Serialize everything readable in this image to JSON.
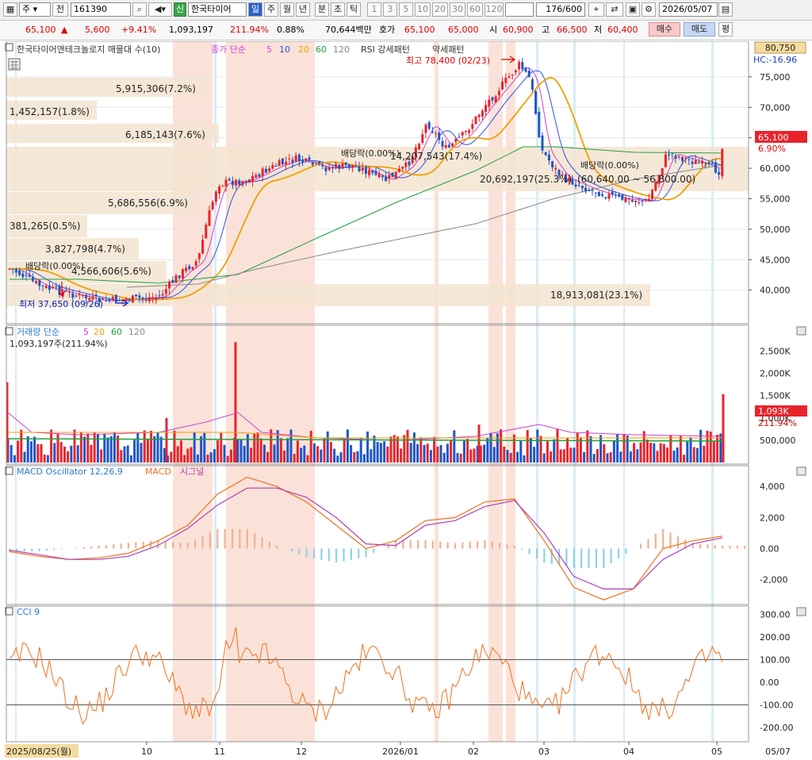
{
  "toolbar": {
    "type_label": "주",
    "jeon_label": "전",
    "stock_code": "161390",
    "market_badge": "신",
    "stock_name": "한국타이어",
    "period_tabs": [
      "일",
      "주",
      "월",
      "년",
      "분",
      "초",
      "틱"
    ],
    "minute_steps": [
      "1",
      "3",
      "5",
      "10",
      "20",
      "30",
      "60",
      "120"
    ],
    "count_display": "176/600",
    "date_value": "2026/05/07"
  },
  "quote": {
    "price": "65,100",
    "change": "5,600",
    "change_pct": "+9.41%",
    "volume": "1,093,197",
    "volume_ratio": "211.94%",
    "turnover_pct": "0.88%",
    "amount": "70,644백만",
    "hoga_label": "호가",
    "ask": "65,100",
    "bid": "65,000",
    "open_label": "시",
    "open": "60,900",
    "high_label": "고",
    "high": "66,500",
    "low_label": "저",
    "low": "60,400",
    "buy_button": "매수",
    "sell_button": "매도",
    "avg_button": "평"
  },
  "price_panel": {
    "header": {
      "title": "한국타이어앤테크놀로지 매물대 수(10)",
      "ma_label": "종가 단순",
      "ma_periods": [
        "5",
        "10",
        "20",
        "60",
        "120"
      ],
      "patterns": [
        "RSI 강세패턴",
        "약세패턴"
      ]
    },
    "y_ticks": [
      "75,000",
      "70,000",
      "65,000",
      "60,000",
      "55,000",
      "50,000",
      "45,000",
      "40,000"
    ],
    "top_tag": "80,750",
    "hc_tag": "HC:-16.96",
    "current_tag": "65,100",
    "current_pct": "6.90%",
    "high_note": "최고 78,400 (02/23)",
    "low_note": "최저 37,650 (09/26)",
    "dividend_labels": [
      "배당락(0.00%)",
      "배당락(0.00%)",
      "배당락(0.00%)"
    ],
    "volume_profile": [
      {
        "value": "5,915,306(7.2%)"
      },
      {
        "value": "1,452,157(1.8%)"
      },
      {
        "value": "6,185,143(7.6%)"
      },
      {
        "value": "14,207,543(17.4%)"
      },
      {
        "value": "20,692,197(25.3%)"
      },
      {
        "value": "5,686,556(6.9%)"
      },
      {
        "value": "381,265(0.5%)"
      },
      {
        "value": "3,827,798(4.7%)"
      },
      {
        "value": "4,566,606(5.6%)"
      },
      {
        "value": "18,913,081(23.1%)"
      }
    ],
    "avg_cost_label": "(60,640.00 ~ 56,800.00)"
  },
  "volume_panel": {
    "title": "거래량 단순",
    "ma_periods": [
      "5",
      "20",
      "60",
      "120"
    ],
    "sub": "1,093,197주(211.94%)",
    "y_ticks": [
      "2,500K",
      "2,000K",
      "1,500K",
      "1,000K",
      "500,000"
    ],
    "current_tag": "1,093K",
    "current_pct": "211.94%"
  },
  "macd_panel": {
    "title": "MACD Oscillator 12,26,9",
    "macd_label": "MACD",
    "signal_label": "시그널",
    "y_ticks": [
      "4,000",
      "2,000",
      "0.00",
      "-2,000"
    ]
  },
  "cci_panel": {
    "title": "CCI 9",
    "y_ticks": [
      "300.00",
      "200.00",
      "100.00",
      "0.00",
      "-100.00",
      "-200.00"
    ]
  },
  "x_axis": {
    "start_label": "2025/08/25(월)",
    "ticks": [
      "10",
      "11",
      "12",
      "2026/01",
      "02",
      "03",
      "04",
      "05"
    ],
    "end_label": "05/07"
  },
  "colors": {
    "up": "#e8242b",
    "down": "#1f56c8",
    "ma5": "#d040d0",
    "ma10": "#3050e0",
    "ma20": "#f0a000",
    "ma60": "#20a040",
    "ma120": "#888888",
    "macd": "#f07020",
    "signal": "#b040b0",
    "highlight": "#f9d8cc",
    "profile": "#f3e4d0"
  },
  "chart_data": [
    {
      "type": "candlestick",
      "title": "한국타이어앤테크놀로지",
      "x_range": [
        "2025/08/25",
        "2026/05/07"
      ],
      "ylim": [
        36000,
        80750
      ],
      "month_ticks": [
        "10",
        "11",
        "12",
        "2026/01",
        "02",
        "03",
        "04",
        "05"
      ],
      "close_points": [
        {
          "date": "2025/08/25",
          "close": 43500
        },
        {
          "date": "2025/09/05",
          "close": 40500
        },
        {
          "date": "2025/09/26",
          "close": 38200
        },
        {
          "date": "2025/10/17",
          "close": 38900
        },
        {
          "date": "2025/10/24",
          "close": 42500
        },
        {
          "date": "2025/10/31",
          "close": 45000
        },
        {
          "date": "2025/11/03",
          "close": 51000
        },
        {
          "date": "2025/11/07",
          "close": 57500
        },
        {
          "date": "2025/11/17",
          "close": 58000
        },
        {
          "date": "2025/11/28",
          "close": 60500
        },
        {
          "date": "2025/12/05",
          "close": 61500
        },
        {
          "date": "2025/12/15",
          "close": 60000
        },
        {
          "date": "2025/12/26",
          "close": 60500
        },
        {
          "date": "2026/01/06",
          "close": 58000
        },
        {
          "date": "2026/01/14",
          "close": 60500
        },
        {
          "date": "2026/01/21",
          "close": 67500
        },
        {
          "date": "2026/01/28",
          "close": 63000
        },
        {
          "date": "2026/02/04",
          "close": 66000
        },
        {
          "date": "2026/02/11",
          "close": 70500
        },
        {
          "date": "2026/02/23",
          "close": 77000
        },
        {
          "date": "2026/02/27",
          "close": 74500
        },
        {
          "date": "2026/03/03",
          "close": 63000
        },
        {
          "date": "2026/03/10",
          "close": 58500
        },
        {
          "date": "2026/03/20",
          "close": 56500
        },
        {
          "date": "2026/03/31",
          "close": 55000
        },
        {
          "date": "2026/04/10",
          "close": 54500
        },
        {
          "date": "2026/04/17",
          "close": 62500
        },
        {
          "date": "2026/04/27",
          "close": 61000
        },
        {
          "date": "2026/05/06",
          "close": 59500
        },
        {
          "date": "2026/05/07",
          "close": 65100
        }
      ],
      "highest": {
        "value": 78400,
        "date": "02/23"
      },
      "lowest": {
        "value": 37650,
        "date": "09/26"
      },
      "moving_averages": [
        "5",
        "10",
        "20",
        "60",
        "120"
      ]
    },
    {
      "type": "bar",
      "title": "거래량",
      "ylim": [
        0,
        2900000
      ],
      "last_value": 1093197,
      "peak_value": 2700000
    },
    {
      "type": "line",
      "title": "MACD Oscillator 12,26,9",
      "series": [
        {
          "name": "MACD",
          "values": [
            -200,
            -500,
            -700,
            -600,
            -300,
            500,
            1500,
            3500,
            4600,
            4000,
            3000,
            1500,
            0,
            500,
            1800,
            2000,
            3000,
            3200,
            500,
            -2500,
            -3300,
            -2600,
            0,
            500,
            800
          ]
        },
        {
          "name": "시그널",
          "values": [
            -100,
            -400,
            -700,
            -700,
            -500,
            200,
            1300,
            2800,
            3900,
            3900,
            3300,
            2000,
            300,
            200,
            1500,
            1800,
            2700,
            3100,
            1000,
            -1800,
            -2600,
            -2600,
            -700,
            300,
            700
          ]
        }
      ],
      "ylim": [
        -3500,
        5000
      ]
    },
    {
      "type": "line",
      "title": "CCI 9",
      "ylim": [
        -250,
        320
      ],
      "levels": [
        100,
        -100
      ],
      "last_value": 90
    }
  ]
}
